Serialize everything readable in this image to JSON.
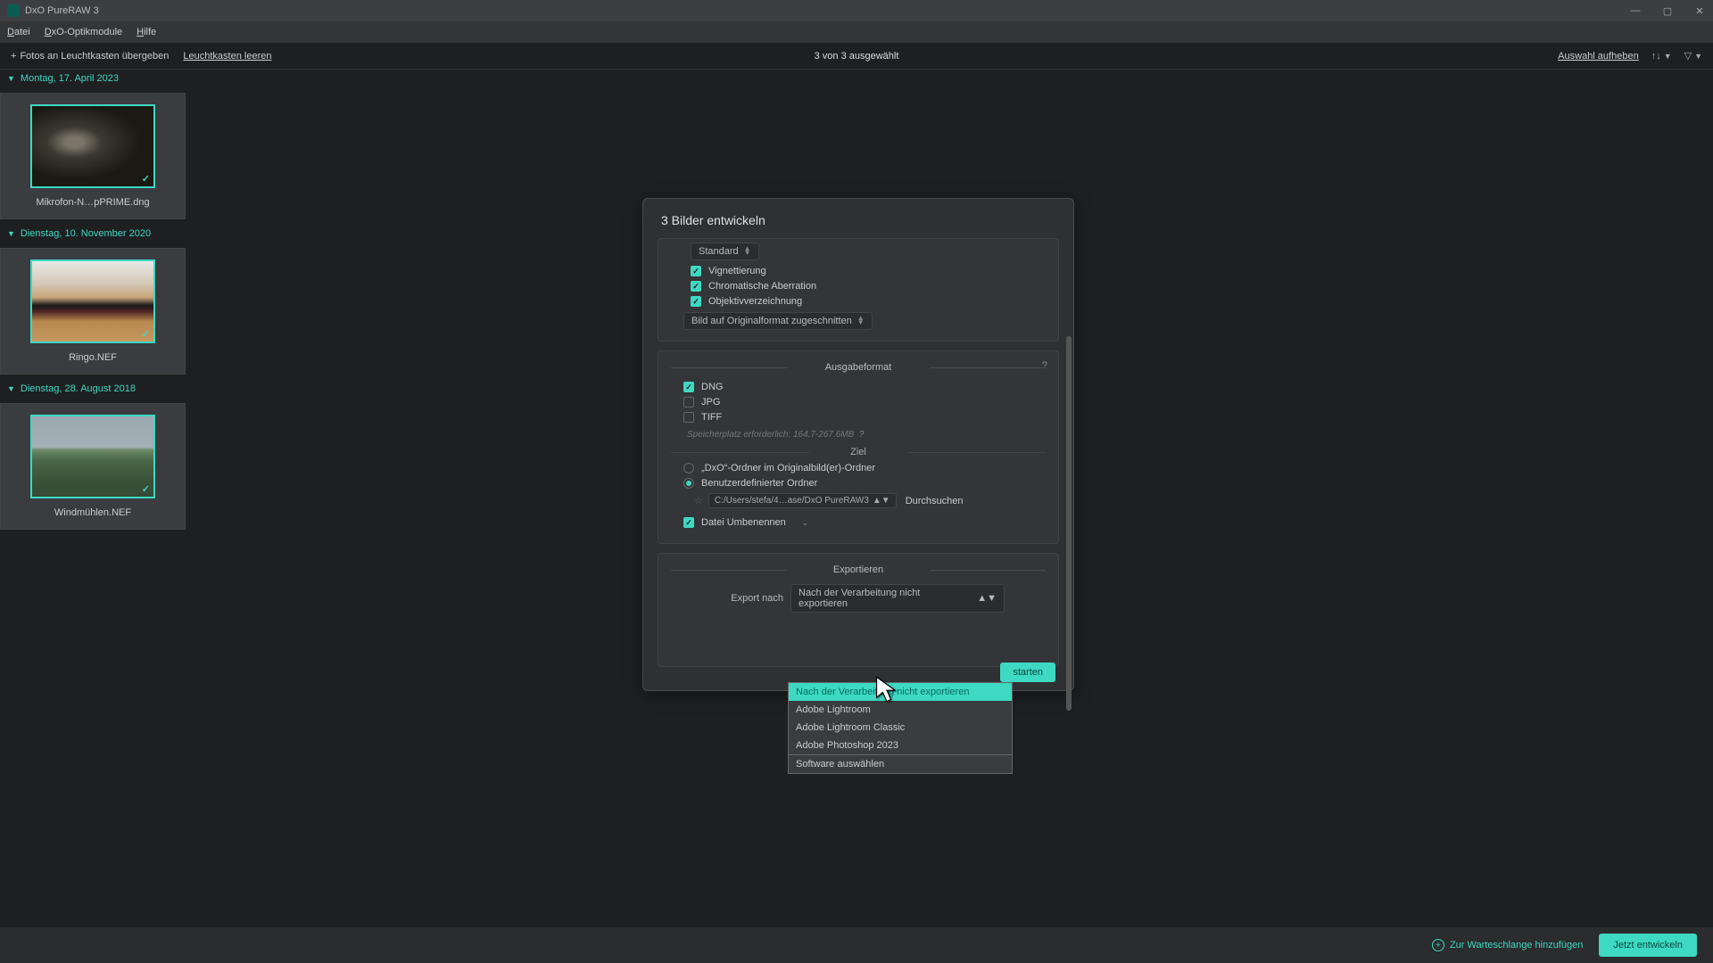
{
  "app": {
    "title": "DxO PureRAW 3"
  },
  "menu": {
    "file": "Datei",
    "modules": "DxO-Optikmodule",
    "help": "Hilfe"
  },
  "toolbar": {
    "add": "Fotos an Leuchtkasten übergeben",
    "clear": "Leuchtkasten leeren",
    "status": "3 von 3 ausgewählt",
    "deselect": "Auswahl aufheben"
  },
  "groups": [
    {
      "date": "Montag, 17. April 2023",
      "items": [
        {
          "label": "Mikrofon-N…pPRIME.dng",
          "thumb": "thumb-1"
        }
      ]
    },
    {
      "date": "Dienstag, 10. November 2020",
      "items": [
        {
          "label": "Ringo.NEF",
          "thumb": "thumb-2"
        }
      ]
    },
    {
      "date": "Dienstag, 28. August 2018",
      "items": [
        {
          "label": "Windmühlen.NEF",
          "thumb": "thumb-3"
        }
      ]
    }
  ],
  "dialog": {
    "title": "3 Bilder entwickeln",
    "top_select": "Standard",
    "corrections": {
      "vign": "Vignettierung",
      "chroma": "Chromatische Aberration",
      "distort": "Objektivverzeichnung"
    },
    "crop_select": "Bild auf Originalformat zugeschnitten",
    "output": {
      "title": "Ausgabeformat",
      "dng": "DNG",
      "jpg": "JPG",
      "tiff": "TIFF",
      "storage": "Speicherplatz erforderlich: 164.7-267.6MB"
    },
    "dest": {
      "title": "Ziel",
      "opt1": "„DxO“-Ordner im Originalbild(er)-Ordner",
      "opt2": "Benutzerdefinierter Ordner",
      "path": "C:/Users/stefa/4…ase/DxO PureRAW3",
      "browse": "Durchsuchen",
      "rename": "Datei Umbenennen"
    },
    "export": {
      "title": "Exportieren",
      "label": "Export nach",
      "selected": "Nach der Verarbeitung nicht exportieren",
      "options": {
        "none": "Nach der Verarbeitung nicht exportieren",
        "lr": "Adobe Lightroom",
        "lrc": "Adobe Lightroom Classic",
        "ps": "Adobe Photoshop 2023",
        "pick": "Software auswählen"
      }
    },
    "start_btn": "starten"
  },
  "bottom": {
    "queue": "Zur Warteschlange hinzufügen",
    "develop": "Jetzt entwickeln"
  }
}
